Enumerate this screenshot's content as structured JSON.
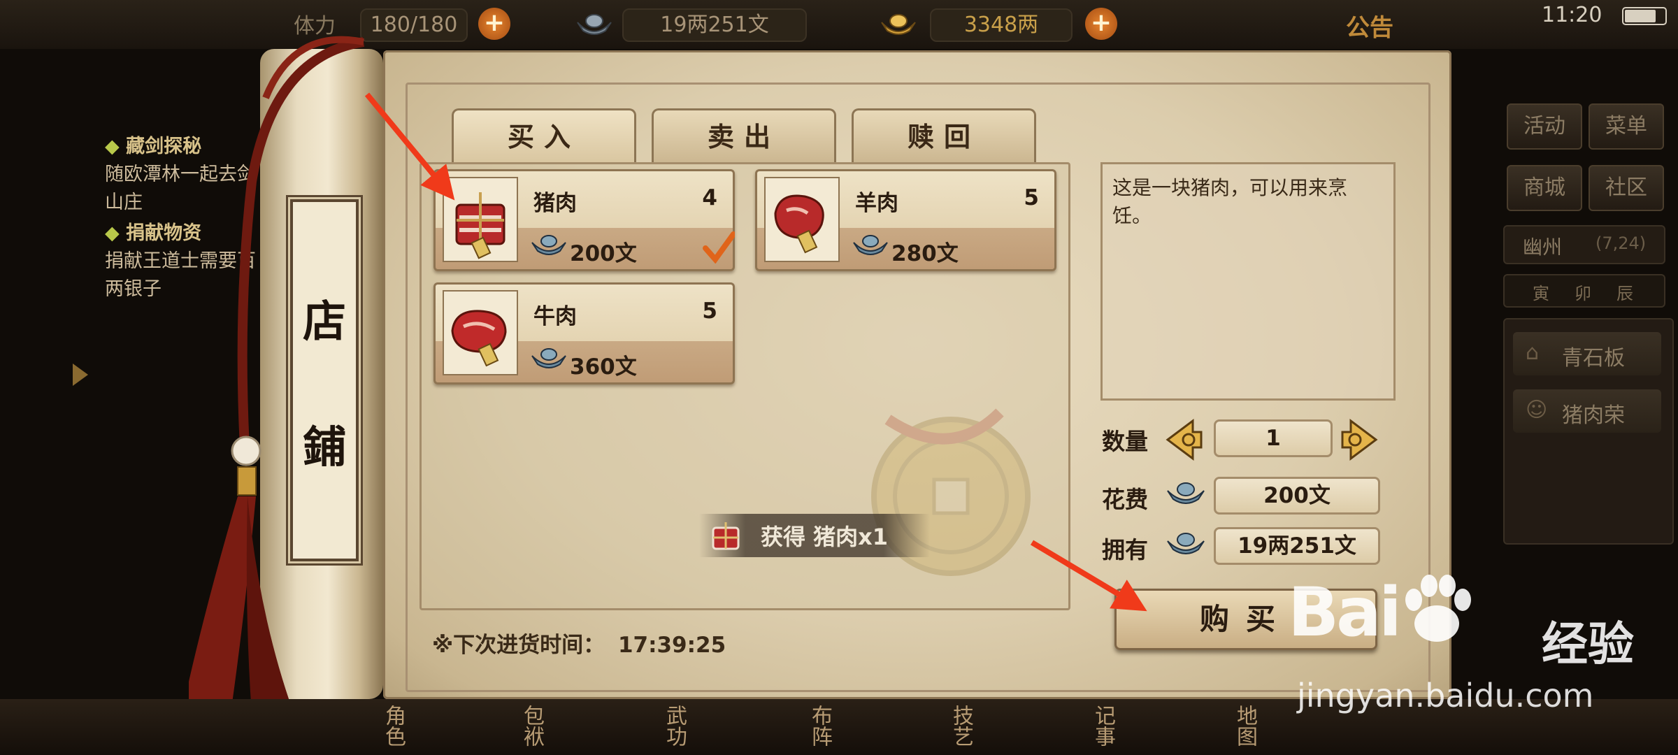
{
  "status": {
    "time": "11:20"
  },
  "topbar": {
    "stamina_label": "体力",
    "stamina_value": "180/180",
    "silver_value": "19两251文",
    "gold_value": "3348两",
    "notice_label": "公告"
  },
  "quests": [
    {
      "title": "藏剑探秘",
      "desc": "随欧潭林一起去剑山庄"
    },
    {
      "title": "捐献物资",
      "desc": "捐献王道士需要百两银子"
    }
  ],
  "side_menu": {
    "buttons": [
      "活动",
      "菜单",
      "商城",
      "社区"
    ],
    "location": "幽州",
    "coords": "(7,24)",
    "time_labels": [
      "寅",
      "卯",
      "辰"
    ],
    "npcs": [
      "青石板",
      "猪肉荣"
    ]
  },
  "shop": {
    "title_chars": [
      "店",
      "鋪"
    ],
    "tabs": [
      "买入",
      "卖出",
      "赎回"
    ],
    "active_tab": "买入",
    "items": [
      {
        "name": "猪肉",
        "count": "4",
        "price": "200文",
        "selected": true
      },
      {
        "name": "羊肉",
        "count": "5",
        "price": "280文",
        "selected": false
      },
      {
        "name": "牛肉",
        "count": "5",
        "price": "360文",
        "selected": false
      }
    ],
    "description": "这是一块猪肉，可以用来烹饪。",
    "quantity_label": "数量",
    "quantity_value": "1",
    "cost_label": "花费",
    "cost_value": "200文",
    "own_label": "拥有",
    "own_value": "19两251文",
    "buy_button": "购买",
    "restock_label": "※下次进货时间：",
    "restock_time": "17:39:25",
    "toast": "获得 猪肉x1"
  },
  "bottom_nav": [
    "角色",
    "包袱",
    "武功",
    "布阵",
    "技艺",
    "记事",
    "地图"
  ],
  "watermark": {
    "brand": "Bai",
    "brand2": "经验",
    "url": "jingyan.baidu.com"
  },
  "colors": {
    "arrow": "#f03a1a",
    "checkmark": "#e0641a",
    "tassel": "#7a1c12"
  }
}
